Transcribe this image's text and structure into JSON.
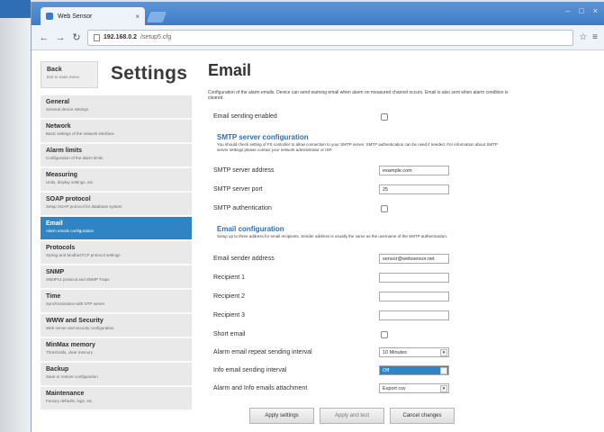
{
  "browser": {
    "tab_title": "Web Sensor",
    "address_host": "192.168.0.2",
    "address_path": "/setup5.cfg"
  },
  "sidebar": {
    "back_label": "Back",
    "back_desc": "Exit to main menu",
    "title": "Settings",
    "items": [
      {
        "title": "General",
        "desc": "General device settings"
      },
      {
        "title": "Network",
        "desc": "Basic settings of the network interface"
      },
      {
        "title": "Alarm limits",
        "desc": "Configuration of the alarm limits"
      },
      {
        "title": "Measuring",
        "desc": "Units, display settings, etc."
      },
      {
        "title": "SOAP protocol",
        "desc": "Setup SOAP protocol for database system"
      },
      {
        "title": "Email",
        "desc": "Alarm emails configuration"
      },
      {
        "title": "Protocols",
        "desc": "Syslog and ModbusTCP protocol settings"
      },
      {
        "title": "SNMP",
        "desc": "SNMPv1 protocol and SNMP Traps"
      },
      {
        "title": "Time",
        "desc": "Synchronization with NTP server"
      },
      {
        "title": "WWW and Security",
        "desc": "Web server and security configuration"
      },
      {
        "title": "MinMax memory",
        "desc": "Thresholds, clear memory"
      },
      {
        "title": "Backup",
        "desc": "Save or restore configuration"
      },
      {
        "title": "Maintenance",
        "desc": "Factory defaults, logs, etc."
      }
    ]
  },
  "main": {
    "title": "Email",
    "intro": "Configuration of the alarm emails. Device can send warning email when alarm on measured channel occurs. Email is also sent when alarm condition is cleared.",
    "email_enabled_label": "Email sending enabled",
    "smtp": {
      "title": "SMTP server configuration",
      "desc": "You should check setting of FS controller to allow connection to your SMTP server. SMTP authentication can be used if needed. For information about SMTP server settings please contact your network administrator or ISP.",
      "address_label": "SMTP server address",
      "address_value": "example.com",
      "port_label": "SMTP server port",
      "port_value": "25",
      "auth_label": "SMTP authentication"
    },
    "email_config": {
      "title": "Email configuration",
      "desc": "Setup up to three address for email recipients. Sender address is usually the same as the username of the SMTP authentication.",
      "sender_label": "Email sender address",
      "sender_value": "sensor@websensor.net",
      "recipient1_label": "Recipient 1",
      "recipient2_label": "Recipient 2",
      "recipient3_label": "Recipient 3",
      "short_label": "Short email",
      "repeat_label": "Alarm email repeat sending interval",
      "repeat_value": "10 Minutes",
      "info_label": "Info email sending interval",
      "info_value": "Off",
      "attach_label": "Alarm and Info emails attachment",
      "attach_value": "Export csv"
    },
    "buttons": {
      "apply": "Apply settings",
      "apply_test": "Apply and test",
      "cancel": "Cancel changes"
    }
  }
}
